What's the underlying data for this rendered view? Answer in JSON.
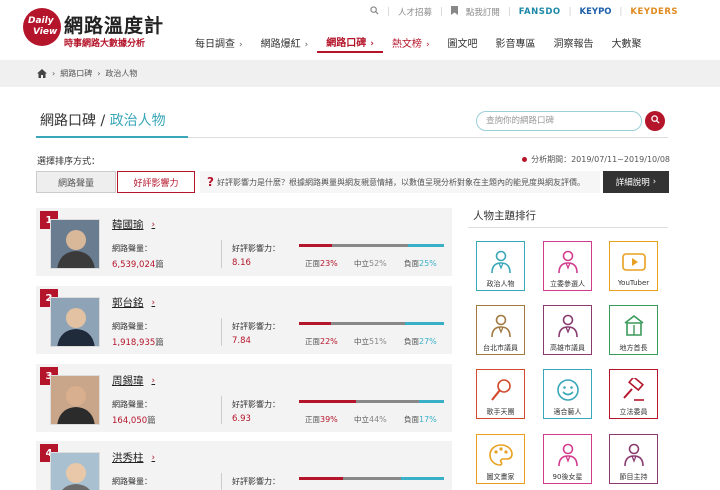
{
  "header": {
    "logo_line1": "Daily",
    "logo_line2": "View",
    "title": "網路溫度計",
    "subtitle": "時事網路大數據分析",
    "top_links": [
      "人才招募",
      "點我訂閱"
    ],
    "brands": [
      "FANSDO",
      "KEYPO",
      "KEYDERS"
    ],
    "nav": [
      {
        "label": "每日調查",
        "chev": "›"
      },
      {
        "label": "網路爆紅",
        "chev": "›"
      },
      {
        "label": "網路口碑",
        "chev": "›"
      },
      {
        "label": "熱文榜",
        "chev": "›"
      },
      {
        "label": "圖文吧"
      },
      {
        "label": "影音專區"
      },
      {
        "label": "洞察報告"
      },
      {
        "label": "大數聚"
      }
    ]
  },
  "breadcrumb": [
    "網路口碑",
    "政治人物"
  ],
  "page": {
    "title_prefix": "網路口碑 /",
    "title_current": "政治人物",
    "search_placeholder": "查詢你的網路口碑",
    "sort_label": "選擇排序方式：",
    "period": "分析期間：2019/07/11~2019/10/08",
    "tabs": [
      "網路聲量",
      "好評影響力"
    ],
    "info": "好評影響力是什麼？根據網路輿量與網友親意情緒，以數值呈現分析對象在主題內的能見度與網友評價。",
    "detail_button": "詳細說明",
    "detail_arrow": "›"
  },
  "labels": {
    "volume": "網路聲量：",
    "influence": "好評影響力：",
    "unit": "篇",
    "positive": "正面",
    "neutral": "中立",
    "negative": "負面"
  },
  "people": [
    {
      "rank": "1",
      "name": "韓國瑜",
      "volume": "6,539,024",
      "influence": "8.16",
      "positive": 23,
      "neutral": 52,
      "negative": 25
    },
    {
      "rank": "2",
      "name": "郭台銘",
      "volume": "1,918,935",
      "influence": "7.84",
      "positive": 22,
      "neutral": 51,
      "negative": 27
    },
    {
      "rank": "3",
      "name": "周錫瑋",
      "volume": "164,050",
      "influence": "6.93",
      "positive": 39,
      "neutral": 44,
      "negative": 17
    },
    {
      "rank": "4",
      "name": "洪秀柱",
      "volume": "",
      "influence": "",
      "positive": 30,
      "neutral": 40,
      "negative": 30
    }
  ],
  "people_text": [
    {
      "pos": "23%",
      "neu": "52%",
      "neg": "25%"
    },
    {
      "pos": "22%",
      "neu": "51%",
      "neg": "27%"
    },
    {
      "pos": "39%",
      "neu": "44%",
      "neg": "17%"
    }
  ],
  "sidebar": {
    "title": "人物主題排行",
    "tiles": [
      {
        "label": "政治人物",
        "icon": "politician-icon",
        "color": "#3aa7b8"
      },
      {
        "label": "立委參選人",
        "icon": "candidate-icon",
        "color": "#d23c8c"
      },
      {
        "label": "YouTuber",
        "icon": "youtube-icon",
        "color": "#e8a020"
      },
      {
        "label": "台北市議員",
        "icon": "taipei-councilor-icon",
        "color": "#a07840"
      },
      {
        "label": "高雄市議員",
        "icon": "kaohsiung-councilor-icon",
        "color": "#8a3a6e"
      },
      {
        "label": "地方首長",
        "icon": "local-chief-icon",
        "color": "#3a9a5a"
      },
      {
        "label": "歌手天團",
        "icon": "microphone-icon",
        "color": "#d24a2e"
      },
      {
        "label": "適合藝人",
        "icon": "smile-icon",
        "color": "#3aa7b8"
      },
      {
        "label": "立法委員",
        "icon": "gavel-icon",
        "color": "#b5152b"
      },
      {
        "label": "圖文畫家",
        "icon": "palette-icon",
        "color": "#e8a020"
      },
      {
        "label": "90後女星",
        "icon": "actress-icon",
        "color": "#d23c8c"
      },
      {
        "label": "節目主持",
        "icon": "host-icon",
        "color": "#8a3a6e"
      }
    ]
  }
}
